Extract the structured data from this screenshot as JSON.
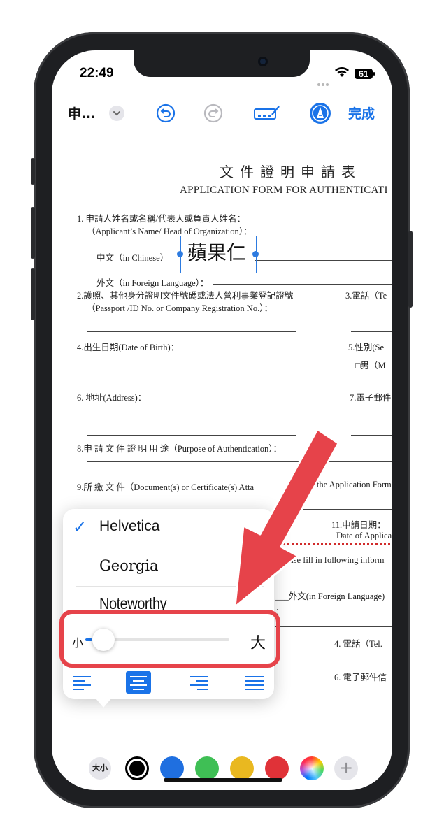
{
  "status_bar": {
    "time": "22:49",
    "battery": "61"
  },
  "toolbar": {
    "doc_title": "申…",
    "done_label": "完成"
  },
  "document": {
    "title_zh": "文件證明申請表",
    "title_en": "APPLICATION FORM FOR AUTHENTICATI",
    "f1_line1": "1.   申請人姓名或名稱/代表人或負責人姓名：",
    "f1_line2": "（Applicant’s Name/ Head of Organization）：",
    "f1_zh": "中文（in Chinese）",
    "signature": "蘋果仁",
    "f1_foreign": "外文（in Foreign Language）：",
    "f2_line1": "2.護照、其他身分證明文件號碼或法人營利事業登記證號",
    "f2_line2": "（Passport /ID No.  or Company Registration No.）：",
    "f3": "3.電話（Te",
    "f4": "4.出生日期(Date of Birth)：",
    "f5": "5.性別(Se",
    "f5_opt": "□男（M",
    "f6": "6.  地址(Address)：",
    "f7": "7.電子郵件",
    "f8": "8.申 請 文 件 證 明 用 途（Purpose of Authentication）：",
    "f9": "9.所    繳    文    件（Document(s) or Certificate(s) Atta",
    "f9_tail": "to the Application Form",
    "f11": "11.申請日期：",
    "f11_en": "Date of Applica",
    "fill_note": "(Please fill in following inform",
    "foreign_lang": "___外文(in Foreign Language)",
    "colon": "：",
    "tel": "4.  電話（Tel.",
    "email": "6.  電子郵件信"
  },
  "font_menu": {
    "fonts": [
      "Helvetica",
      "Georgia",
      "Noteworthy"
    ],
    "selected_check": "✓",
    "size_small": "小",
    "size_large": "大",
    "size_level": 0.05
  },
  "color_bar": {
    "size_label": "大小",
    "colors": [
      "#000000",
      "#1f6fe0",
      "#3fbf55",
      "#e9b820",
      "#e03238"
    ],
    "add_symbol": "+"
  },
  "accents": {
    "highlight": "#e6434a",
    "brand": "#1a73e8"
  }
}
